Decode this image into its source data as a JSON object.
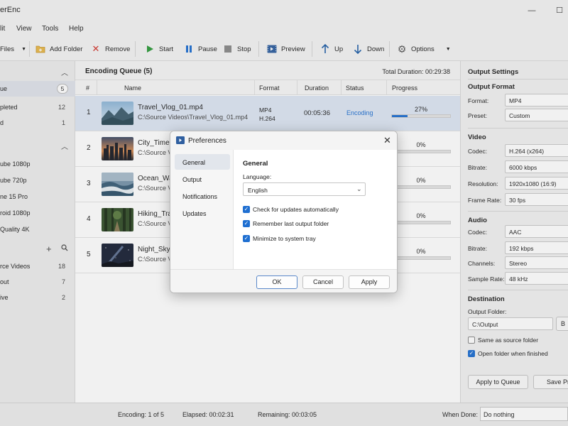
{
  "window": {
    "title": "erEnc",
    "controls": {
      "minimize": "—",
      "maximize": "☐"
    }
  },
  "menu": [
    "lit",
    "View",
    "Tools",
    "Help"
  ],
  "toolbar": {
    "files_label": "Files",
    "add_folder": "Add Folder",
    "remove": "Remove",
    "start": "Start",
    "pause": "Pause",
    "stop": "Stop",
    "preview": "Preview",
    "up": "Up",
    "down": "Down",
    "options": "Options"
  },
  "sidebar": {
    "status_items": [
      {
        "label": "ue",
        "count": "5"
      },
      {
        "label": "pleted",
        "count": "12"
      },
      {
        "label": "d",
        "count": "1"
      }
    ],
    "presets": [
      "ube 1080p",
      "ube 720p",
      "ne 15 Pro",
      "roid 1080p",
      "Quality 4K"
    ],
    "folders": [
      {
        "label": "rce Videos",
        "count": "18"
      },
      {
        "label": "out",
        "count": "7"
      },
      {
        "label": "ive",
        "count": "2"
      }
    ]
  },
  "queue": {
    "title": "Encoding Queue (5)",
    "total_duration": "Total Duration: 00:29:38",
    "columns": [
      "#",
      "Name",
      "Format",
      "Duration",
      "Status",
      "Progress"
    ],
    "rows": [
      {
        "num": "1",
        "name": "Travel_Vlog_01.mp4",
        "path": "C:\\Source Videos\\Travel_Vlog_01.mp4",
        "format1": "MP4",
        "format2": "H.264",
        "duration": "00:05:36",
        "status": "Encoding",
        "progress_label": "27%",
        "progress": 0.27
      },
      {
        "num": "2",
        "name": "City_Timel",
        "path": "C:\\Source Vi",
        "progress_label": "0%",
        "progress": 0
      },
      {
        "num": "3",
        "name": "Ocean_Wa",
        "path": "C:\\Source Vi",
        "progress_label": "0%",
        "progress": 0
      },
      {
        "num": "4",
        "name": "Hiking_Tra",
        "path": "C:\\Source Vi",
        "progress_label": "0%",
        "progress": 0
      },
      {
        "num": "5",
        "name": "Night_Sky_",
        "path": "C:\\Source Vi",
        "progress_label": "0%",
        "progress": 0
      }
    ]
  },
  "settings": {
    "title": "Output Settings",
    "output_format": {
      "heading": "Output Format",
      "format_label": "Format:",
      "format_value": "MP4",
      "preset_label": "Preset:",
      "preset_value": "Custom"
    },
    "video": {
      "heading": "Video",
      "codec_label": "Codec:",
      "codec_value": "H.264 (x264)",
      "bitrate_label": "Bitrate:",
      "bitrate_value": "6000 kbps",
      "resolution_label": "Resolution:",
      "resolution_value": "1920x1080 (16:9)",
      "framerate_label": "Frame Rate:",
      "framerate_value": "30 fps"
    },
    "audio": {
      "heading": "Audio",
      "codec_label": "Codec:",
      "codec_value": "AAC",
      "bitrate_label": "Bitrate:",
      "bitrate_value": "192 kbps",
      "channels_label": "Channels:",
      "channels_value": "Stereo",
      "samplerate_label": "Sample Rate:",
      "samplerate_value": "48 kHz"
    },
    "destination": {
      "heading": "Destination",
      "folder_label": "Output Folder:",
      "folder_value": "C:\\Output",
      "browse": "B",
      "same_as_source": "Same as source folder",
      "open_when_finished": "Open folder when finished"
    },
    "apply_queue": "Apply to Queue",
    "save_preset": "Save Pre"
  },
  "statusbar": {
    "encoding": "Encoding: 1 of 5",
    "elapsed": "Elapsed:  00:02:31",
    "remaining": "Remaining:  00:03:05",
    "when_done_label": "When Done:",
    "when_done_value": "Do nothing"
  },
  "dialog": {
    "title": "Preferences",
    "nav": [
      "General",
      "Output",
      "Notifications",
      "Updates"
    ],
    "section_title": "General",
    "language_label": "Language:",
    "language_value": "English",
    "checkboxes": [
      "Check for updates automatically",
      "Remember last output folder",
      "Minimize to system tray"
    ],
    "ok": "OK",
    "cancel": "Cancel",
    "apply": "Apply"
  },
  "colors": {
    "accent": "#1f6fd1",
    "selected_row": "#dde6f3"
  }
}
